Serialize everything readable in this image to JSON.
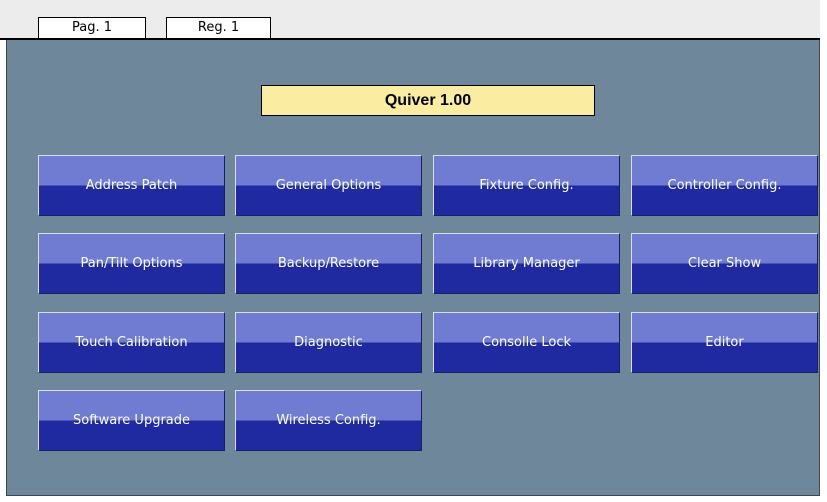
{
  "tabs": {
    "page_label": "Pag. 1",
    "reg_label": "Reg. 1"
  },
  "header": {
    "version_title": "Quiver 1.00"
  },
  "menu": {
    "buttons": [
      "Address Patch",
      "General Options",
      "Fixture Config.",
      "Controller Config.",
      "Pan/Tilt Options",
      "Backup/Restore",
      "Library Manager",
      "Clear Show",
      "Touch Calibration",
      "Diagnostic",
      "Consolle Lock",
      "Editor",
      "Software Upgrade",
      "Wireless Config."
    ]
  },
  "colors": {
    "panel_background": "#6f879b",
    "version_box": "#faeca0",
    "button_top": "#6f7cd2",
    "button_bottom": "#1f2aa0"
  }
}
